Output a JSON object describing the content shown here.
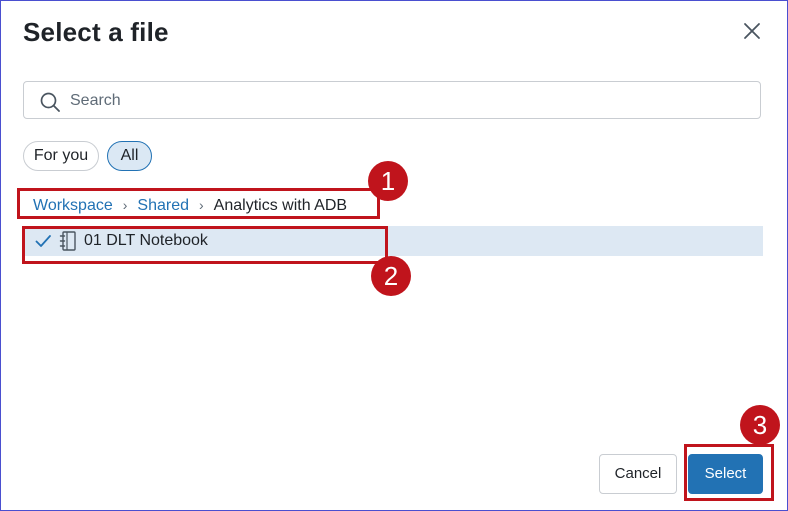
{
  "dialog": {
    "title": "Select a file",
    "close_icon": "close-icon"
  },
  "search": {
    "placeholder": "Search",
    "value": "",
    "icon": "search-icon"
  },
  "filters": {
    "for_you": "For you",
    "all": "All",
    "selected": "All"
  },
  "breadcrumb": {
    "items": [
      "Workspace",
      "Shared",
      "Analytics with ADB"
    ],
    "separator": "›"
  },
  "files": [
    {
      "name": "01 DLT Notebook",
      "type_icon": "notebook-icon",
      "selected": true,
      "check_icon": "checkmark-icon"
    }
  ],
  "buttons": {
    "cancel": "Cancel",
    "select": "Select"
  },
  "annotations": {
    "labels": [
      "1",
      "2",
      "3"
    ],
    "color": "#c0141c"
  },
  "colors": {
    "accent": "#2272b4",
    "selected_row": "#dde8f3",
    "frame": "#4a4fd0"
  }
}
